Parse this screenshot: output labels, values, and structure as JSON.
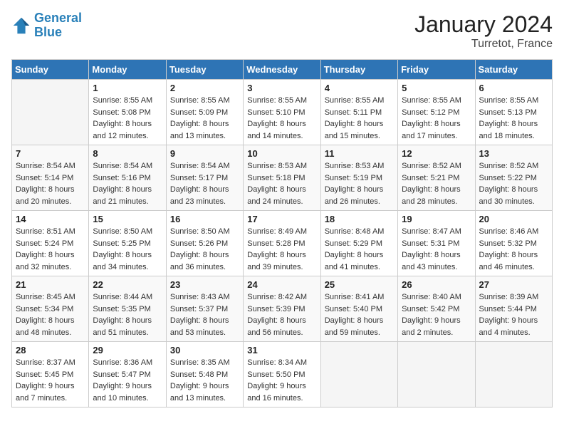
{
  "header": {
    "logo_line1": "General",
    "logo_line2": "Blue",
    "month": "January 2024",
    "location": "Turretot, France"
  },
  "weekdays": [
    "Sunday",
    "Monday",
    "Tuesday",
    "Wednesday",
    "Thursday",
    "Friday",
    "Saturday"
  ],
  "weeks": [
    [
      {
        "day": "",
        "sunrise": "",
        "sunset": "",
        "daylight": ""
      },
      {
        "day": "1",
        "sunrise": "Sunrise: 8:55 AM",
        "sunset": "Sunset: 5:08 PM",
        "daylight": "Daylight: 8 hours and 12 minutes."
      },
      {
        "day": "2",
        "sunrise": "Sunrise: 8:55 AM",
        "sunset": "Sunset: 5:09 PM",
        "daylight": "Daylight: 8 hours and 13 minutes."
      },
      {
        "day": "3",
        "sunrise": "Sunrise: 8:55 AM",
        "sunset": "Sunset: 5:10 PM",
        "daylight": "Daylight: 8 hours and 14 minutes."
      },
      {
        "day": "4",
        "sunrise": "Sunrise: 8:55 AM",
        "sunset": "Sunset: 5:11 PM",
        "daylight": "Daylight: 8 hours and 15 minutes."
      },
      {
        "day": "5",
        "sunrise": "Sunrise: 8:55 AM",
        "sunset": "Sunset: 5:12 PM",
        "daylight": "Daylight: 8 hours and 17 minutes."
      },
      {
        "day": "6",
        "sunrise": "Sunrise: 8:55 AM",
        "sunset": "Sunset: 5:13 PM",
        "daylight": "Daylight: 8 hours and 18 minutes."
      }
    ],
    [
      {
        "day": "7",
        "sunrise": "Sunrise: 8:54 AM",
        "sunset": "Sunset: 5:14 PM",
        "daylight": "Daylight: 8 hours and 20 minutes."
      },
      {
        "day": "8",
        "sunrise": "Sunrise: 8:54 AM",
        "sunset": "Sunset: 5:16 PM",
        "daylight": "Daylight: 8 hours and 21 minutes."
      },
      {
        "day": "9",
        "sunrise": "Sunrise: 8:54 AM",
        "sunset": "Sunset: 5:17 PM",
        "daylight": "Daylight: 8 hours and 23 minutes."
      },
      {
        "day": "10",
        "sunrise": "Sunrise: 8:53 AM",
        "sunset": "Sunset: 5:18 PM",
        "daylight": "Daylight: 8 hours and 24 minutes."
      },
      {
        "day": "11",
        "sunrise": "Sunrise: 8:53 AM",
        "sunset": "Sunset: 5:19 PM",
        "daylight": "Daylight: 8 hours and 26 minutes."
      },
      {
        "day": "12",
        "sunrise": "Sunrise: 8:52 AM",
        "sunset": "Sunset: 5:21 PM",
        "daylight": "Daylight: 8 hours and 28 minutes."
      },
      {
        "day": "13",
        "sunrise": "Sunrise: 8:52 AM",
        "sunset": "Sunset: 5:22 PM",
        "daylight": "Daylight: 8 hours and 30 minutes."
      }
    ],
    [
      {
        "day": "14",
        "sunrise": "Sunrise: 8:51 AM",
        "sunset": "Sunset: 5:24 PM",
        "daylight": "Daylight: 8 hours and 32 minutes."
      },
      {
        "day": "15",
        "sunrise": "Sunrise: 8:50 AM",
        "sunset": "Sunset: 5:25 PM",
        "daylight": "Daylight: 8 hours and 34 minutes."
      },
      {
        "day": "16",
        "sunrise": "Sunrise: 8:50 AM",
        "sunset": "Sunset: 5:26 PM",
        "daylight": "Daylight: 8 hours and 36 minutes."
      },
      {
        "day": "17",
        "sunrise": "Sunrise: 8:49 AM",
        "sunset": "Sunset: 5:28 PM",
        "daylight": "Daylight: 8 hours and 39 minutes."
      },
      {
        "day": "18",
        "sunrise": "Sunrise: 8:48 AM",
        "sunset": "Sunset: 5:29 PM",
        "daylight": "Daylight: 8 hours and 41 minutes."
      },
      {
        "day": "19",
        "sunrise": "Sunrise: 8:47 AM",
        "sunset": "Sunset: 5:31 PM",
        "daylight": "Daylight: 8 hours and 43 minutes."
      },
      {
        "day": "20",
        "sunrise": "Sunrise: 8:46 AM",
        "sunset": "Sunset: 5:32 PM",
        "daylight": "Daylight: 8 hours and 46 minutes."
      }
    ],
    [
      {
        "day": "21",
        "sunrise": "Sunrise: 8:45 AM",
        "sunset": "Sunset: 5:34 PM",
        "daylight": "Daylight: 8 hours and 48 minutes."
      },
      {
        "day": "22",
        "sunrise": "Sunrise: 8:44 AM",
        "sunset": "Sunset: 5:35 PM",
        "daylight": "Daylight: 8 hours and 51 minutes."
      },
      {
        "day": "23",
        "sunrise": "Sunrise: 8:43 AM",
        "sunset": "Sunset: 5:37 PM",
        "daylight": "Daylight: 8 hours and 53 minutes."
      },
      {
        "day": "24",
        "sunrise": "Sunrise: 8:42 AM",
        "sunset": "Sunset: 5:39 PM",
        "daylight": "Daylight: 8 hours and 56 minutes."
      },
      {
        "day": "25",
        "sunrise": "Sunrise: 8:41 AM",
        "sunset": "Sunset: 5:40 PM",
        "daylight": "Daylight: 8 hours and 59 minutes."
      },
      {
        "day": "26",
        "sunrise": "Sunrise: 8:40 AM",
        "sunset": "Sunset: 5:42 PM",
        "daylight": "Daylight: 9 hours and 2 minutes."
      },
      {
        "day": "27",
        "sunrise": "Sunrise: 8:39 AM",
        "sunset": "Sunset: 5:44 PM",
        "daylight": "Daylight: 9 hours and 4 minutes."
      }
    ],
    [
      {
        "day": "28",
        "sunrise": "Sunrise: 8:37 AM",
        "sunset": "Sunset: 5:45 PM",
        "daylight": "Daylight: 9 hours and 7 minutes."
      },
      {
        "day": "29",
        "sunrise": "Sunrise: 8:36 AM",
        "sunset": "Sunset: 5:47 PM",
        "daylight": "Daylight: 9 hours and 10 minutes."
      },
      {
        "day": "30",
        "sunrise": "Sunrise: 8:35 AM",
        "sunset": "Sunset: 5:48 PM",
        "daylight": "Daylight: 9 hours and 13 minutes."
      },
      {
        "day": "31",
        "sunrise": "Sunrise: 8:34 AM",
        "sunset": "Sunset: 5:50 PM",
        "daylight": "Daylight: 9 hours and 16 minutes."
      },
      {
        "day": "",
        "sunrise": "",
        "sunset": "",
        "daylight": ""
      },
      {
        "day": "",
        "sunrise": "",
        "sunset": "",
        "daylight": ""
      },
      {
        "day": "",
        "sunrise": "",
        "sunset": "",
        "daylight": ""
      }
    ]
  ]
}
